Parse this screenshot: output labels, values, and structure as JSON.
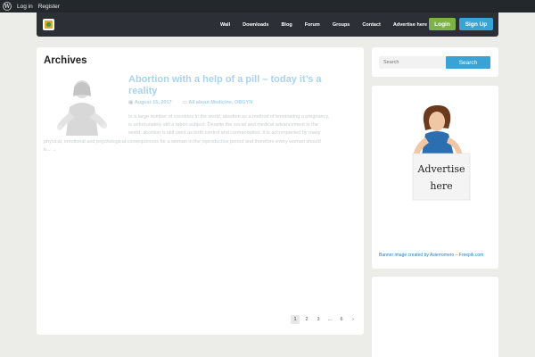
{
  "adminbar": {
    "login": "Log in",
    "register": "Register"
  },
  "nav": {
    "items": [
      "Wall",
      "Downloads",
      "Blog",
      "Forum",
      "Groups",
      "Contact",
      "Advertise here"
    ],
    "login": "Login",
    "signup": "Sign Up"
  },
  "main": {
    "heading": "Archives",
    "post": {
      "title": "Abortion with a help of a pill – today it’s a reality",
      "date": "August 15, 2017",
      "category": "All about Medicine, OBGYN",
      "excerpt_1": "In a large number of countries in the world, abortion as a method of terminating a pregnancy,",
      "excerpt_2": "is unfortunately still a taboo subject. Despite the social and medical advancement in the",
      "excerpt_3": "world, abortion is still used as birth control and contraception. It is accompanied by many",
      "excerpt_4": "physical, emotional and psychological consequences for a woman in the reproductive period and therefore every woman should",
      "excerpt_5": "b... →"
    },
    "pagination": [
      "1",
      "2",
      "3",
      "...",
      "6",
      "›"
    ]
  },
  "sidebar": {
    "search_placeholder": "Search",
    "search_button": "Search",
    "ad_line1": "Advertise",
    "ad_line2": "here",
    "ad_credit": "Banner image created by Asierromero – Freepik.com"
  }
}
